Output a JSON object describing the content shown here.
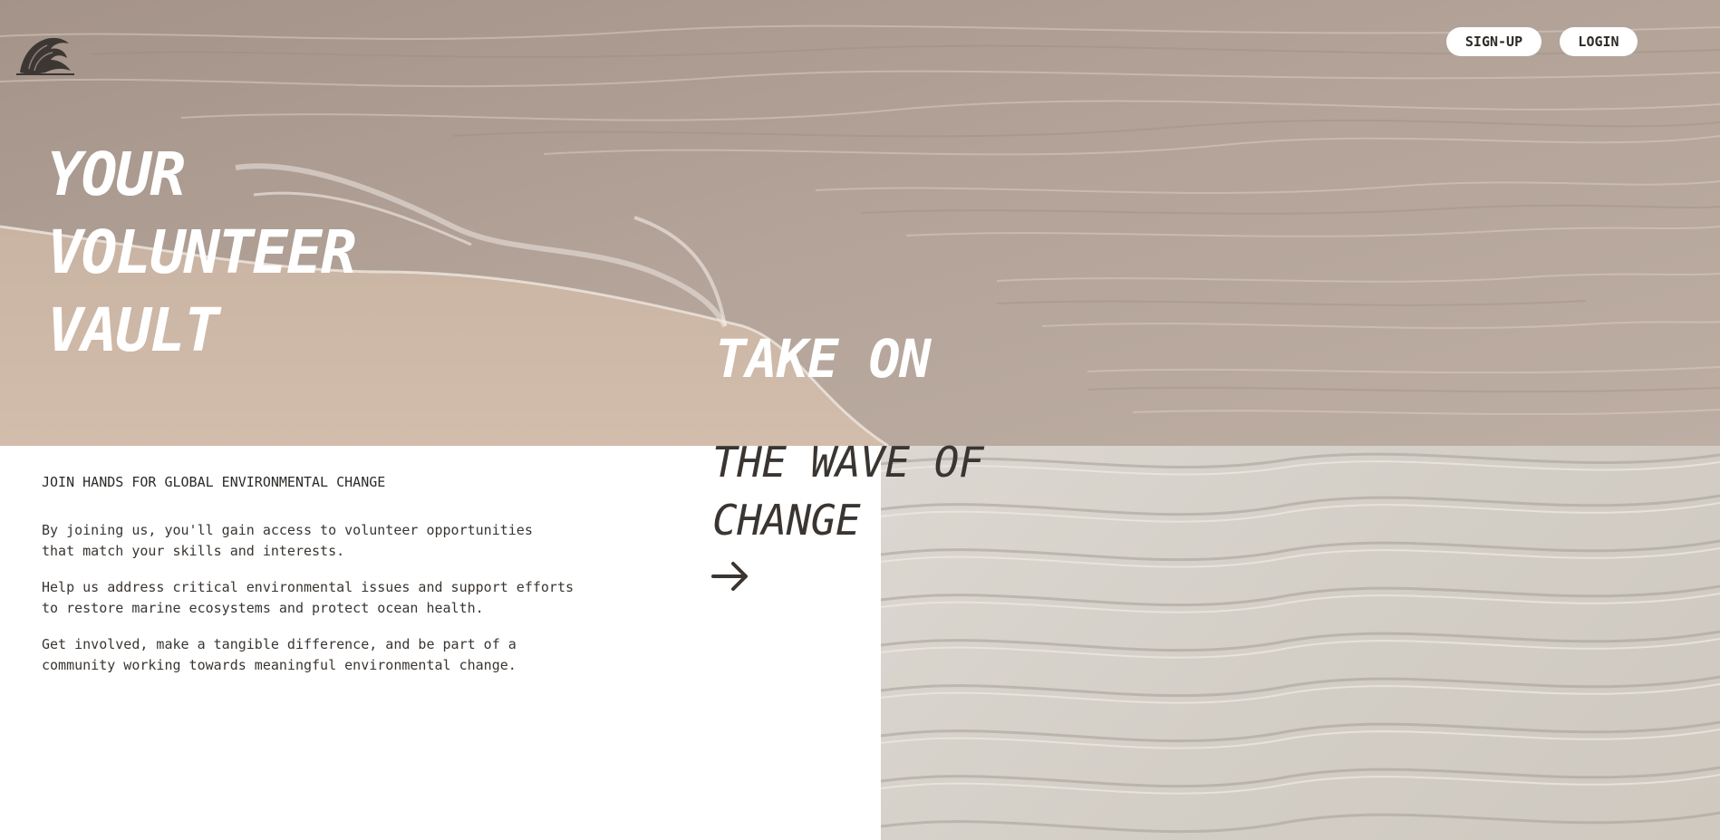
{
  "nav": {
    "signup_label": "SIGN-UP",
    "login_label": "LOGIN"
  },
  "logo": {
    "icon": "wave-logo-icon"
  },
  "hero": {
    "title_lines": [
      "YOUR",
      "VOLUNTEER",
      "VAULT"
    ],
    "take_on": "TAKE ON",
    "wave_of_change": "THE WAVE OF\nCHANGE",
    "arrow_icon": "arrow-right-icon"
  },
  "content": {
    "subhead": "JOIN HANDS FOR GLOBAL ENVIRONMENTAL CHANGE",
    "paragraphs": [
      "By joining us, you'll gain access to volunteer opportunities\nthat match your skills and interests.",
      "Help us address critical environmental issues and support efforts\nto restore marine ecosystems and protect ocean health.",
      "Get involved, make a tangible difference, and be part of a\ncommunity working towards meaningful environmental change."
    ]
  },
  "colors": {
    "text_dark": "#2e2a27",
    "heading_dark": "#3a3531",
    "white": "#ffffff",
    "sand": "#d3cec6",
    "ocean": "#b5a69c"
  }
}
